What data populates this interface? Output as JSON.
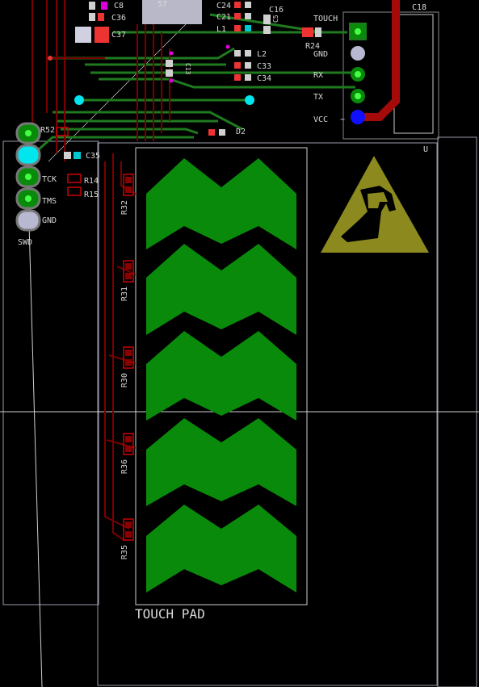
{
  "colors": {
    "background": "#000000",
    "trace_top": "#8b0000",
    "trace_bottom": "#1f7a1f",
    "copper_pad": "#0a8a0a",
    "silkscreen": "#d8d8d8",
    "warning_symbol": "#8c8a1e",
    "via": "#00e5ee",
    "pad_blue": "#1010ff",
    "crosshair": "#cfcfcf"
  },
  "labels": {
    "touch_pad": "TOUCH PAD",
    "touch": "TOUCH",
    "gnd_top": "GND",
    "rx": "RX",
    "tx": "TX",
    "vcc": "VCC",
    "gnd_swd": "GND",
    "swd": "SWD",
    "tck": "TCK",
    "tms": "TMS",
    "d2": "D2",
    "r52": "R52",
    "c35": "C35",
    "r14": "R14",
    "r15": "R15",
    "r24": "R24",
    "c8": "C8",
    "c36": "C36",
    "c37": "C37",
    "c24": "C24",
    "c21": "C21",
    "l1": "L1",
    "c16": "C16",
    "l2": "L2",
    "c33": "C33",
    "c34": "C34",
    "c18": "C18",
    "c5": "C5",
    "c3": "C3",
    "c13": "C13",
    "u": "U",
    "r32": "R32",
    "r31": "R31",
    "r30": "R30",
    "r36": "R36",
    "r35": "R35",
    "ic_mark": "57",
    "tilde": "~"
  }
}
